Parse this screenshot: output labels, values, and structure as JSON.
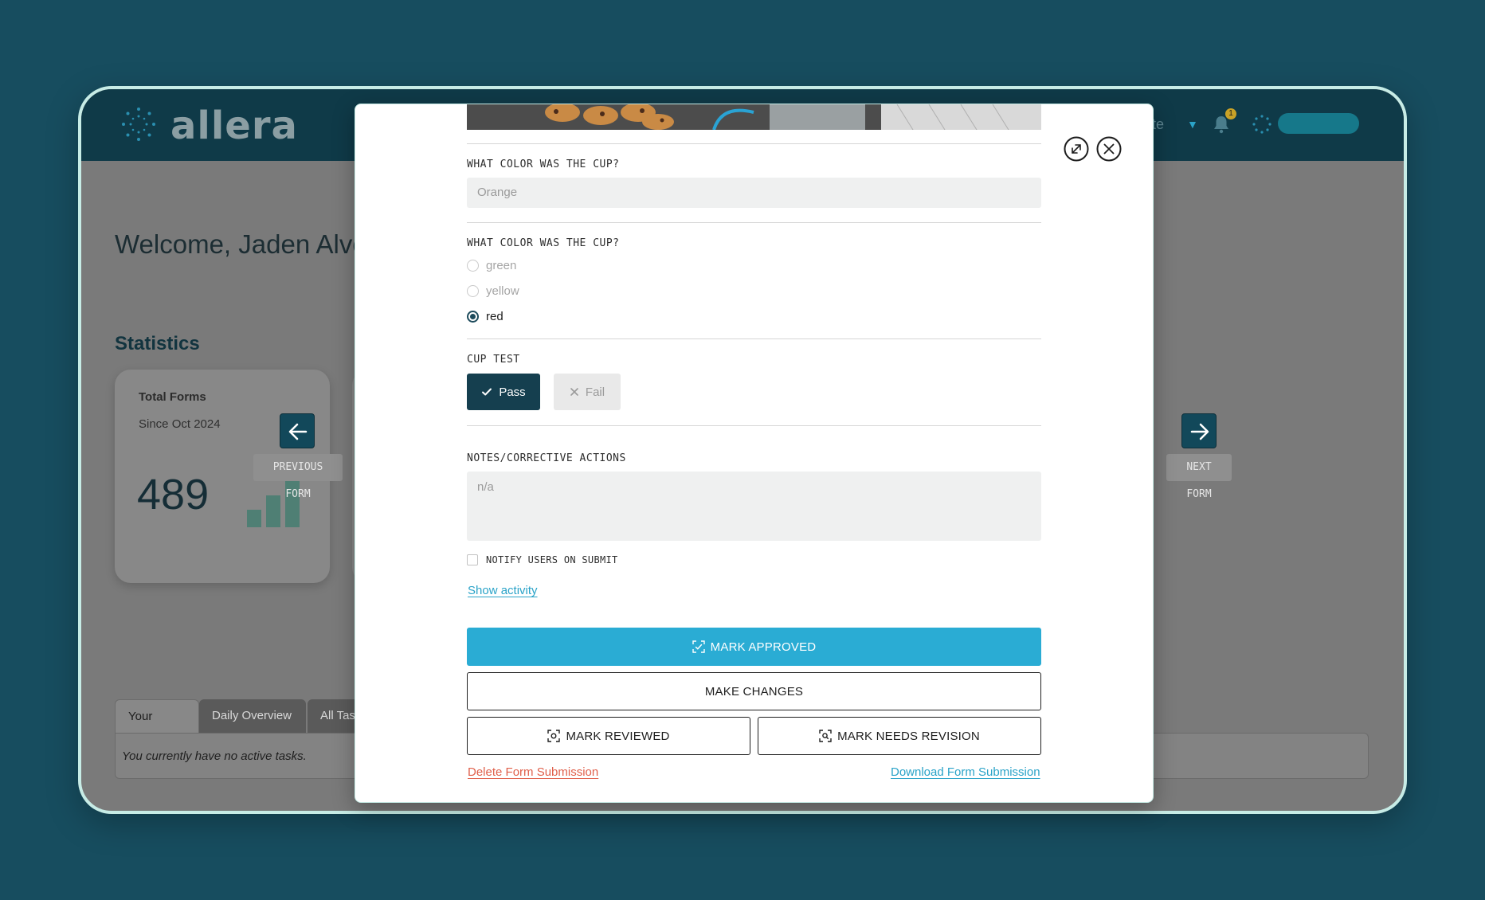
{
  "app": {
    "logo": "allera",
    "site_fragment": "ite",
    "notification_count": "1",
    "colors": {
      "brand_dark": "#0f3a48",
      "accent": "#2aacd4",
      "danger": "#e0604b"
    }
  },
  "dashboard": {
    "welcome": "Welcome, Jaden Alve",
    "statistics_title": "Statistics",
    "card": {
      "label": "Total Forms",
      "sub": "Since Oct 2024",
      "value": "489"
    },
    "tabs": [
      "Your Tasks",
      "Daily Overview",
      "All Tas"
    ],
    "tasks_empty": "You currently have no active tasks."
  },
  "nav": {
    "prev_label": "PREVIOUS FORM",
    "next_label": "NEXT FORM"
  },
  "modal": {
    "q1": {
      "label": "WHAT COLOR WAS THE CUP?",
      "value": "Orange"
    },
    "q2": {
      "label": "WHAT COLOR WAS THE CUP?",
      "options": [
        {
          "label": "green",
          "selected": false
        },
        {
          "label": "yellow",
          "selected": false
        },
        {
          "label": "red",
          "selected": true
        }
      ]
    },
    "cup_test": {
      "label": "CUP TEST",
      "pass": "Pass",
      "fail": "Fail",
      "selected": "Pass"
    },
    "notes": {
      "label": "NOTES/CORRECTIVE ACTIONS",
      "placeholder": "n/a"
    },
    "notify_label": "NOTIFY USERS ON SUBMIT",
    "show_activity": "Show activity",
    "buttons": {
      "approve": "MARK APPROVED",
      "changes": "MAKE CHANGES",
      "reviewed": "MARK REVIEWED",
      "revision": "MARK NEEDS REVISION"
    },
    "delete_link": "Delete Form Submission",
    "download_link": "Download Form Submission"
  }
}
